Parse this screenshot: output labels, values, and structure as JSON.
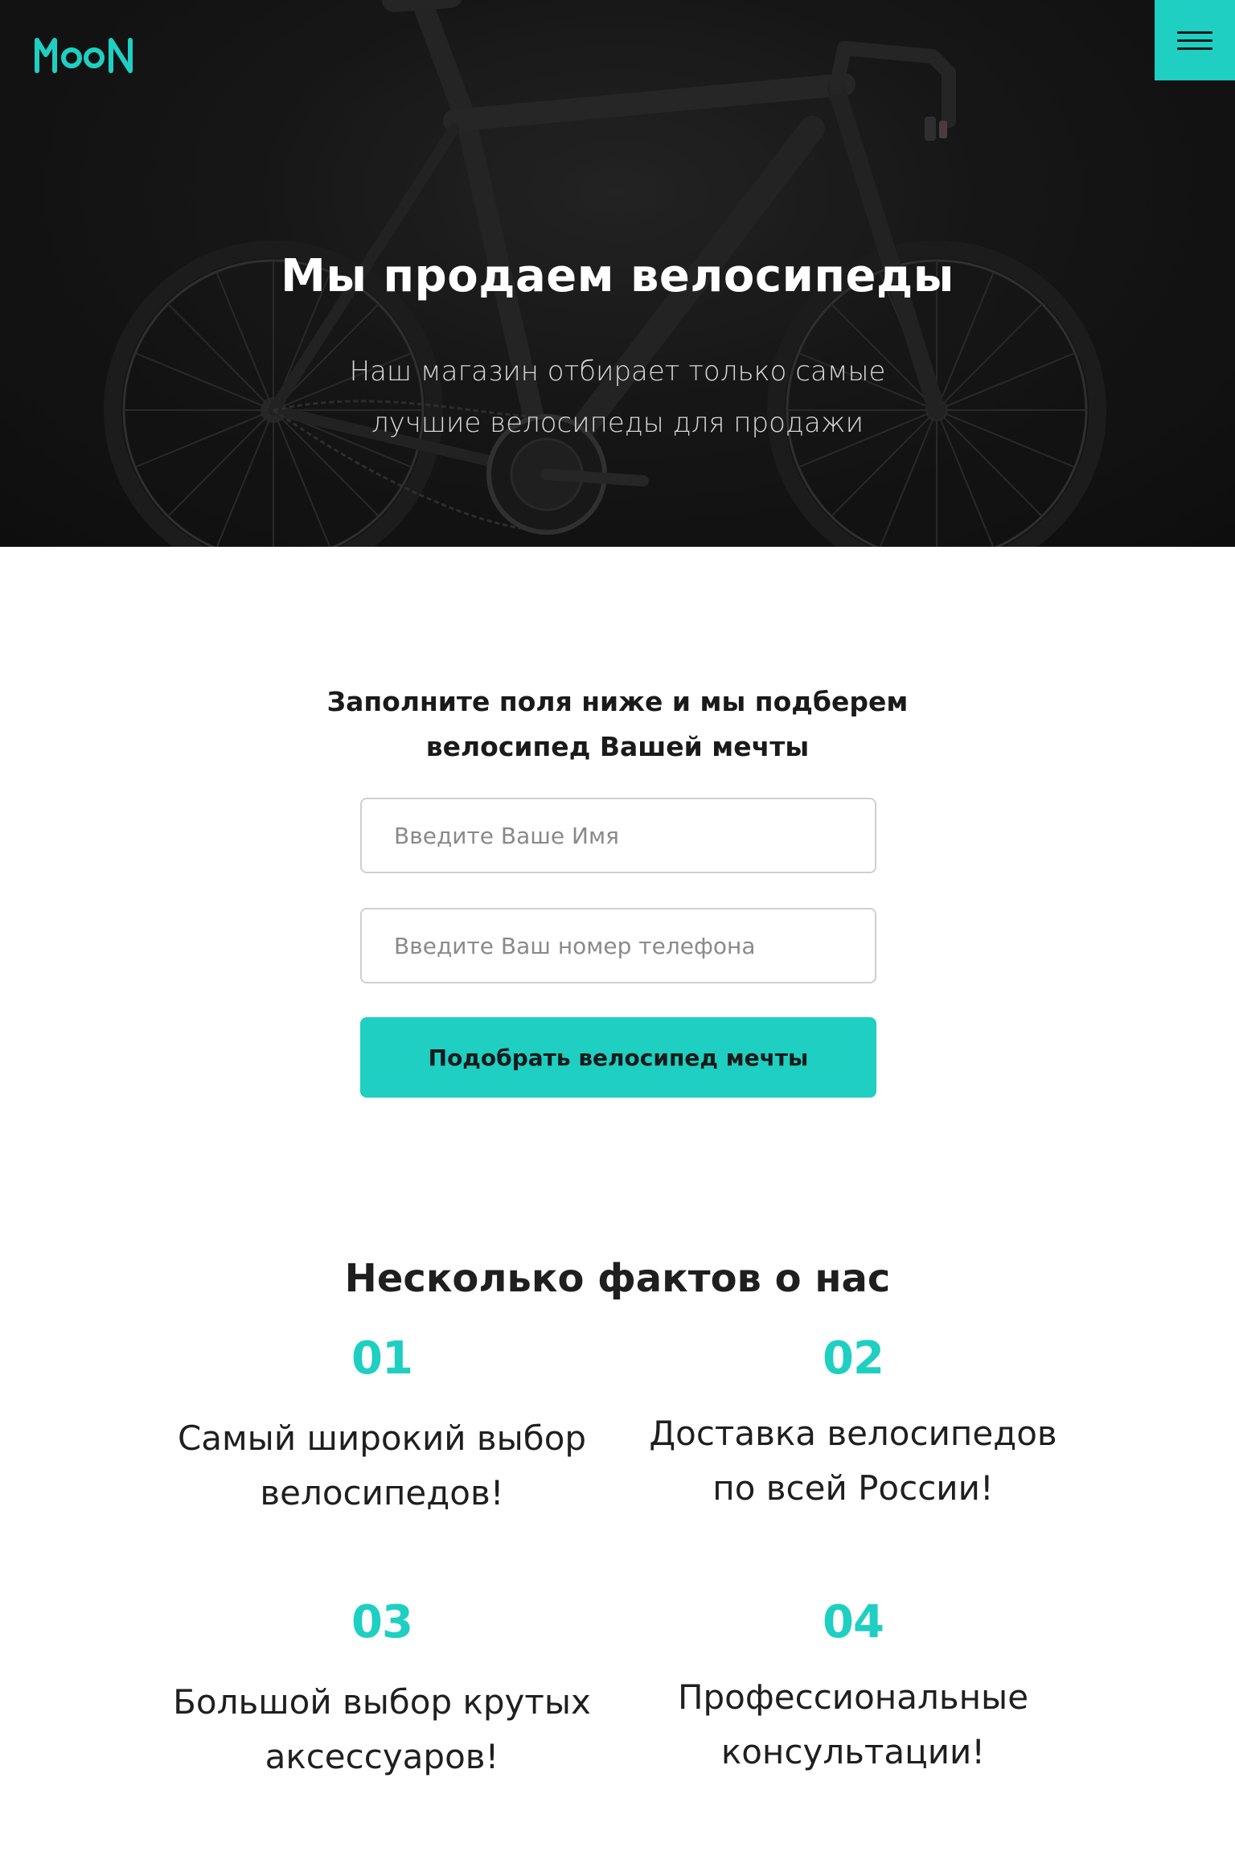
{
  "colors": {
    "accent": "#1ecfc2",
    "hero_background": "#1b1b1b",
    "text_dark": "#1f1f1f"
  },
  "header": {
    "logo": "MOON",
    "menu_icon": "hamburger-menu-icon"
  },
  "hero": {
    "title": "Мы продаем велосипеды",
    "subtitle": "Наш магазин отбирает только самые лучшие велосипеды для продажи",
    "background_image": "bicycle-photo"
  },
  "form": {
    "heading": "Заполните поля ниже и мы подберем велосипед Вашей мечты",
    "name_placeholder": "Введите Ваше Имя",
    "phone_placeholder": "Введите Ваш номер телефона",
    "submit_label": "Подобрать велосипед мечты"
  },
  "facts": {
    "heading": "Несколько фактов о нас",
    "items": [
      {
        "number": "01",
        "text": "Самый широкий выбор велосипедов!"
      },
      {
        "number": "02",
        "text": "Доставка велосипедов по всей России!"
      },
      {
        "number": "03",
        "text": "Большой выбор крутых аксессуаров!"
      },
      {
        "number": "04",
        "text": "Профессиональные консультации!"
      }
    ]
  }
}
